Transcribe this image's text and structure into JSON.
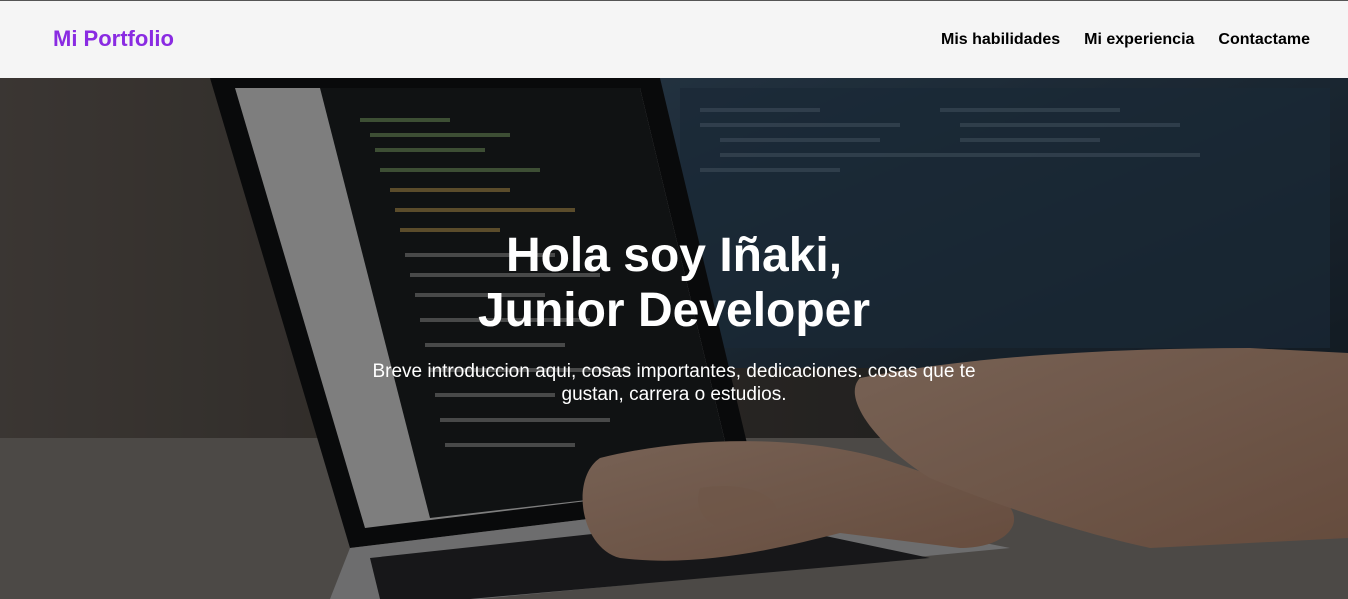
{
  "navbar": {
    "brand": "Mi Portfolio",
    "links": [
      "Mis habilidades",
      "Mi experiencia",
      "Contactame"
    ]
  },
  "hero": {
    "title_line1": "Hola soy Iñaki,",
    "title_line2": "Junior Developer",
    "subtitle": "Breve introduccion aqui, cosas importantes, dedicaciones. cosas que te gustan, carrera o estudios.",
    "background_image": "laptop-coding-hands-photo"
  },
  "colors": {
    "brand": "#8a2be2",
    "navbar_bg": "#f5f5f5",
    "nav_text": "#000000",
    "hero_text": "#ffffff"
  }
}
